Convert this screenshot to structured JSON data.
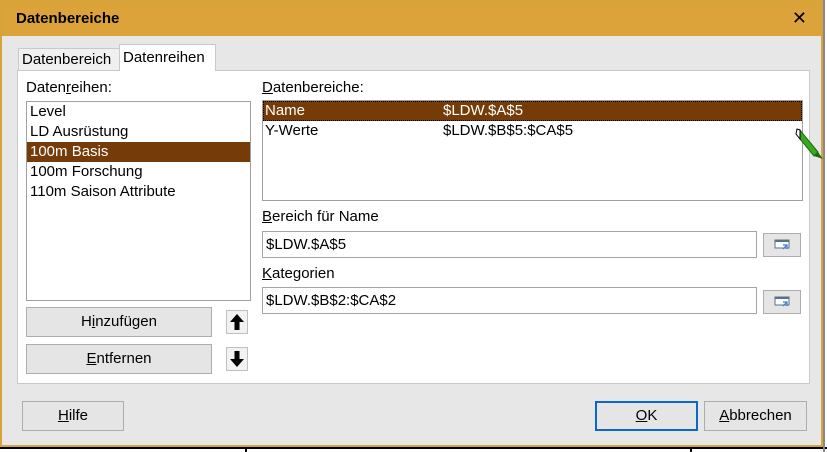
{
  "dialog": {
    "title": "Datenbereiche",
    "close_glyph": "✕"
  },
  "tabs": [
    {
      "label": "Datenbereich"
    },
    {
      "label": "Datenreihen"
    }
  ],
  "series": {
    "label_pre": "Daten",
    "label_u": "r",
    "label_post": "eihen:",
    "items": [
      "Level",
      "LD Ausrüstung",
      "100m Basis",
      "100m Forschung",
      "110m Saison Attribute"
    ],
    "selected_index": 2
  },
  "ranges": {
    "label_u": "D",
    "label_rest": "atenbereiche:",
    "rows": [
      {
        "name": "Name",
        "value": "$LDW.$A$5"
      },
      {
        "name": "Y-Werte",
        "value": "$LDW.$B$5:$CA$5"
      }
    ],
    "selected_index": 0
  },
  "name_range": {
    "label_u": "B",
    "label_rest": "ereich für Name",
    "value": "$LDW.$A$5"
  },
  "categories": {
    "label_u": "K",
    "label_rest": "ategorien",
    "value": "$LDW.$B$2:$CA$2"
  },
  "buttons": {
    "add": {
      "pre": "H",
      "u": "i",
      "post": "nzufügen"
    },
    "remove": {
      "pre": "",
      "u": "E",
      "post": "ntfernen"
    },
    "help": {
      "pre": "",
      "u": "H",
      "post": "ilfe"
    },
    "ok": {
      "pre": "",
      "u": "O",
      "post": "K"
    },
    "cancel": {
      "pre": "",
      "u": "A",
      "post": "bbrechen"
    }
  },
  "colors": {
    "title_bar": "#dba339",
    "selection": "#753c09",
    "default_button_border": "#0a66d0"
  }
}
